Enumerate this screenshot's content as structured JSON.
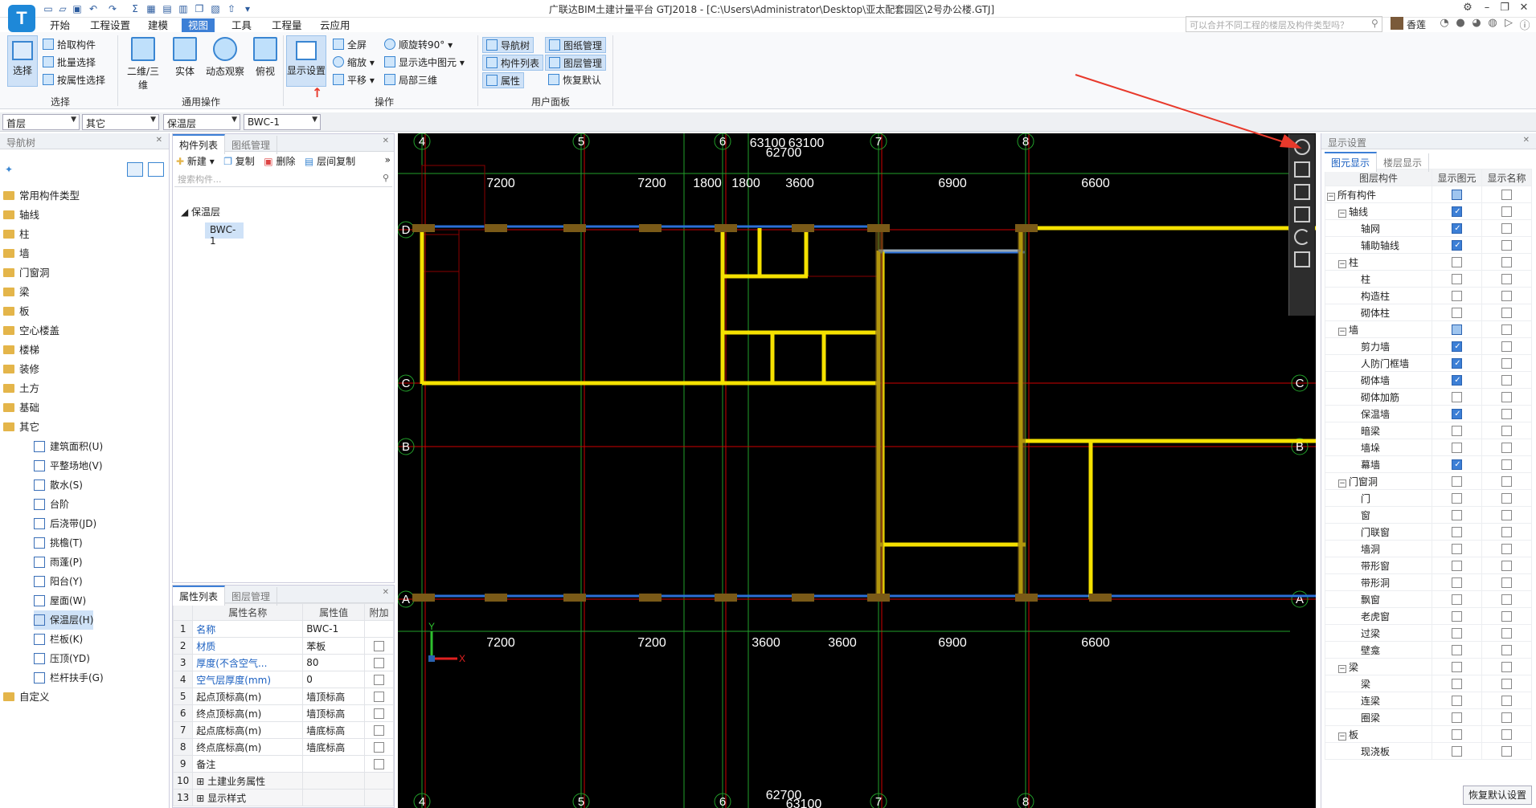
{
  "title": "广联达BIM土建计量平台 GTJ2018 - [C:\\Users\\Administrator\\Desktop\\亚太配套园区\\2号办公楼.GTJ]",
  "search_placeholder": "可以合并不同工程的楼层及构件类型吗？",
  "user_name": "香莲",
  "menu": [
    "开始",
    "工程设置",
    "建模",
    "视图",
    "工具",
    "工程量",
    "云应用"
  ],
  "menu_active": "视图",
  "ribbon": {
    "select_group": {
      "label": "选择",
      "big": "选择",
      "items": [
        "拾取构件",
        "批量选择",
        "按属性选择"
      ]
    },
    "common_group": {
      "label": "通用操作",
      "buttons": [
        "二维/三维",
        "实体",
        "动态观察",
        "俯视"
      ]
    },
    "ops_group": {
      "label": "操作",
      "big": "显示设置",
      "col1": [
        "全屏",
        "缩放",
        "平移"
      ],
      "col2": [
        "顺旋转90°",
        "显示选中图元",
        "局部三维"
      ]
    },
    "user_group": {
      "label": "用户面板",
      "col1": [
        "导航树",
        "构件列表",
        "属性"
      ],
      "col2": [
        "图纸管理",
        "图层管理",
        "恢复默认"
      ]
    }
  },
  "dropdowns": [
    "首层",
    "其它",
    "保温层",
    "BWC-1"
  ],
  "nav": {
    "title": "导航树",
    "items": [
      "常用构件类型",
      "轴线",
      "柱",
      "墙",
      "门窗洞",
      "梁",
      "板",
      "空心楼盖",
      "楼梯",
      "装修",
      "土方",
      "基础",
      "其它"
    ],
    "sub_items": [
      "建筑面积(U)",
      "平整场地(V)",
      "散水(S)",
      "台阶",
      "后浇带(JD)",
      "挑檐(T)",
      "雨蓬(P)",
      "阳台(Y)",
      "屋面(W)",
      "保温层(H)",
      "栏板(K)",
      "压顶(YD)",
      "栏杆扶手(G)"
    ],
    "selected": "保温层(H)",
    "last": "自定义"
  },
  "complist": {
    "tabs": [
      "构件列表",
      "图纸管理"
    ],
    "toolbar": [
      "新建",
      "复制",
      "删除",
      "层间复制"
    ],
    "search_placeholder": "搜索构件...",
    "group": "保温层",
    "item": "BWC-1"
  },
  "props": {
    "tabs": [
      "属性列表",
      "图层管理"
    ],
    "headers": [
      "属性名称",
      "属性值",
      "附加"
    ],
    "rows": [
      {
        "n": "1",
        "name": "名称",
        "value": "BWC-1",
        "blue": true,
        "cb": false
      },
      {
        "n": "2",
        "name": "材质",
        "value": "苯板",
        "blue": true,
        "cb": true
      },
      {
        "n": "3",
        "name": "厚度(不含空气...",
        "value": "80",
        "blue": true,
        "cb": true
      },
      {
        "n": "4",
        "name": "空气层厚度(mm)",
        "value": "0",
        "blue": true,
        "cb": true
      },
      {
        "n": "5",
        "name": "起点顶标高(m)",
        "value": "墙顶标高",
        "blue": false,
        "cb": true
      },
      {
        "n": "6",
        "name": "终点顶标高(m)",
        "value": "墙顶标高",
        "blue": false,
        "cb": true
      },
      {
        "n": "7",
        "name": "起点底标高(m)",
        "value": "墙底标高",
        "blue": false,
        "cb": true
      },
      {
        "n": "8",
        "name": "终点底标高(m)",
        "value": "墙底标高",
        "blue": false,
        "cb": true
      },
      {
        "n": "9",
        "name": "备注",
        "value": "",
        "blue": false,
        "cb": true
      },
      {
        "n": "10",
        "name": "土建业务属性",
        "value": "",
        "blue": false,
        "cb": false
      },
      {
        "n": "13",
        "name": "显示样式",
        "value": "",
        "blue": false,
        "cb": false
      }
    ]
  },
  "canvas": {
    "top_axes": [
      "4",
      "5",
      "6",
      "7",
      "8"
    ],
    "bottom_axes": [
      "4",
      "5",
      "6",
      "7",
      "8"
    ],
    "top_dims": [
      "7200",
      "7200",
      "1800",
      "1800",
      "3600",
      "6900",
      "6600"
    ],
    "top_total": [
      "63100",
      "63100",
      "62700"
    ],
    "bottom_dims": [
      "7200",
      "7200",
      "3600",
      "3600",
      "6900",
      "6600"
    ],
    "bottom_total": [
      "62700",
      "63100"
    ],
    "left_axes": [
      "D",
      "C",
      "B",
      "A"
    ],
    "right_axes": [
      "C",
      "B",
      "A"
    ],
    "ucs_x": "X",
    "ucs_y": "Y"
  },
  "display": {
    "title": "显示设置",
    "tabs": [
      "图元显示",
      "楼层显示"
    ],
    "headers": [
      "图层构件",
      "显示图元",
      "显示名称"
    ],
    "rows": [
      {
        "label": "所有构件",
        "lvl": 0,
        "exp": "-",
        "s": "part",
        "n": "off"
      },
      {
        "label": "轴线",
        "lvl": 1,
        "exp": "-",
        "s": "on",
        "n": "off"
      },
      {
        "label": "轴网",
        "lvl": 2,
        "exp": "",
        "s": "on",
        "n": "off"
      },
      {
        "label": "辅助轴线",
        "lvl": 2,
        "exp": "",
        "s": "on",
        "n": "off"
      },
      {
        "label": "柱",
        "lvl": 1,
        "exp": "-",
        "s": "off",
        "n": "off"
      },
      {
        "label": "柱",
        "lvl": 2,
        "exp": "",
        "s": "off",
        "n": "off"
      },
      {
        "label": "构造柱",
        "lvl": 2,
        "exp": "",
        "s": "off",
        "n": "off"
      },
      {
        "label": "砌体柱",
        "lvl": 2,
        "exp": "",
        "s": "off",
        "n": "off"
      },
      {
        "label": "墙",
        "lvl": 1,
        "exp": "-",
        "s": "part",
        "n": "off"
      },
      {
        "label": "剪力墙",
        "lvl": 2,
        "exp": "",
        "s": "on",
        "n": "off"
      },
      {
        "label": "人防门框墙",
        "lvl": 2,
        "exp": "",
        "s": "on",
        "n": "off"
      },
      {
        "label": "砌体墙",
        "lvl": 2,
        "exp": "",
        "s": "on",
        "n": "off"
      },
      {
        "label": "砌体加筋",
        "lvl": 2,
        "exp": "",
        "s": "off",
        "n": "off"
      },
      {
        "label": "保温墙",
        "lvl": 2,
        "exp": "",
        "s": "on",
        "n": "off"
      },
      {
        "label": "暗梁",
        "lvl": 2,
        "exp": "",
        "s": "off",
        "n": "off"
      },
      {
        "label": "墙垛",
        "lvl": 2,
        "exp": "",
        "s": "off",
        "n": "off"
      },
      {
        "label": "幕墙",
        "lvl": 2,
        "exp": "",
        "s": "on",
        "n": "off"
      },
      {
        "label": "门窗洞",
        "lvl": 1,
        "exp": "-",
        "s": "off",
        "n": "off"
      },
      {
        "label": "门",
        "lvl": 2,
        "exp": "",
        "s": "off",
        "n": "off"
      },
      {
        "label": "窗",
        "lvl": 2,
        "exp": "",
        "s": "off",
        "n": "off"
      },
      {
        "label": "门联窗",
        "lvl": 2,
        "exp": "",
        "s": "off",
        "n": "off"
      },
      {
        "label": "墙洞",
        "lvl": 2,
        "exp": "",
        "s": "off",
        "n": "off"
      },
      {
        "label": "带形窗",
        "lvl": 2,
        "exp": "",
        "s": "off",
        "n": "off"
      },
      {
        "label": "带形洞",
        "lvl": 2,
        "exp": "",
        "s": "off",
        "n": "off"
      },
      {
        "label": "飘窗",
        "lvl": 2,
        "exp": "",
        "s": "off",
        "n": "off"
      },
      {
        "label": "老虎窗",
        "lvl": 2,
        "exp": "",
        "s": "off",
        "n": "off"
      },
      {
        "label": "过梁",
        "lvl": 2,
        "exp": "",
        "s": "off",
        "n": "off"
      },
      {
        "label": "壁龛",
        "lvl": 2,
        "exp": "",
        "s": "off",
        "n": "off"
      },
      {
        "label": "梁",
        "lvl": 1,
        "exp": "-",
        "s": "off",
        "n": "off"
      },
      {
        "label": "梁",
        "lvl": 2,
        "exp": "",
        "s": "off",
        "n": "off"
      },
      {
        "label": "连梁",
        "lvl": 2,
        "exp": "",
        "s": "off",
        "n": "off"
      },
      {
        "label": "圈梁",
        "lvl": 2,
        "exp": "",
        "s": "off",
        "n": "off"
      },
      {
        "label": "板",
        "lvl": 1,
        "exp": "-",
        "s": "off",
        "n": "off"
      },
      {
        "label": "现浇板",
        "lvl": 2,
        "exp": "",
        "s": "off",
        "n": "off"
      }
    ],
    "restore": "恢复默认设置"
  },
  "colors": {
    "accent": "#3c7fd6",
    "wall": "#f5e100",
    "axis_green": "#22a02a",
    "axis_red": "#d00000",
    "arrow": "#e8392b"
  }
}
